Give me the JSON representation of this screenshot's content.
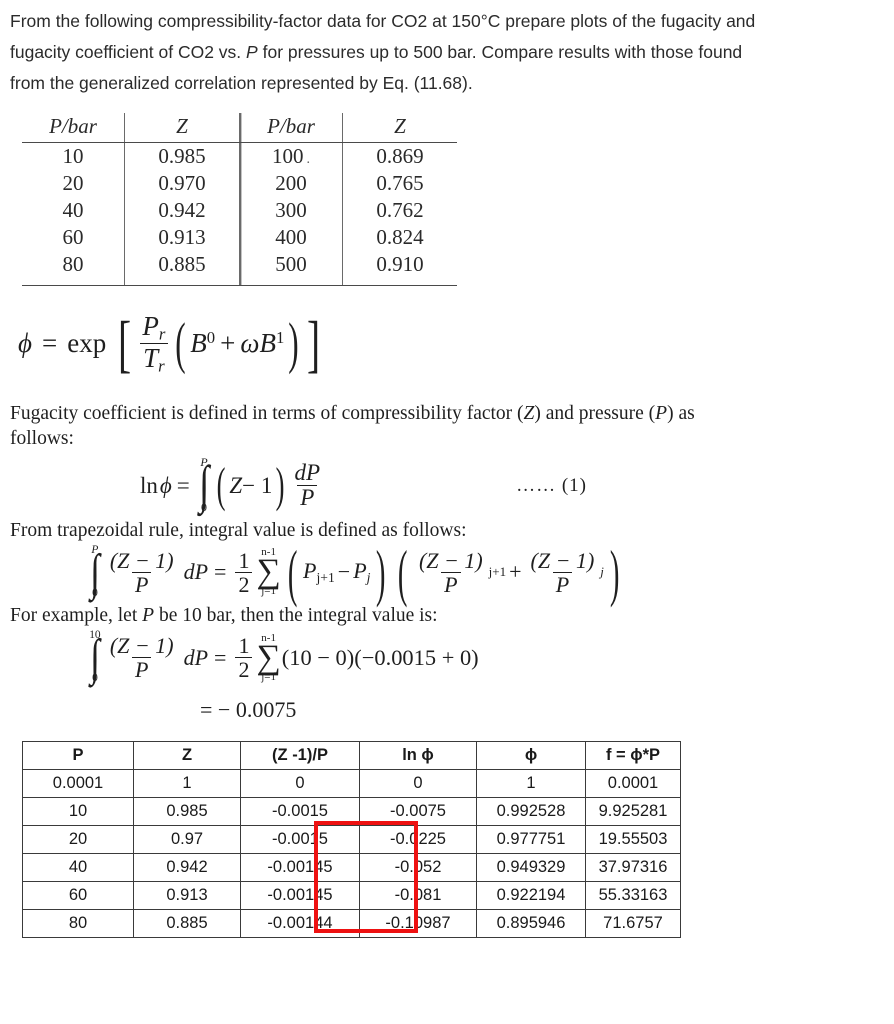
{
  "problem": {
    "text_line1": "From the following compressibility-factor data for CO2 at 150°C prepare plots of the fugacity and",
    "text_line2_a": "fugacity coefficient of CO2 vs. ",
    "text_line2_italic": "P",
    "text_line2_b": " for pressures up to 500 bar. Compare results with those found",
    "text_line3": "from the generalized correlation represented by Eq. (11.68)."
  },
  "z_table": {
    "headers": [
      "P/bar",
      "Z",
      "P/bar",
      "Z"
    ],
    "left_rows": [
      {
        "p": "10",
        "z": "0.985"
      },
      {
        "p": "20",
        "z": "0.970"
      },
      {
        "p": "40",
        "z": "0.942"
      },
      {
        "p": "60",
        "z": "0.913"
      },
      {
        "p": "80",
        "z": "0.885"
      }
    ],
    "right_rows": [
      {
        "p": "100",
        "mark": ".",
        "z": "0.869"
      },
      {
        "p": "200",
        "mark": "",
        "z": "0.765"
      },
      {
        "p": "300",
        "mark": "",
        "z": "0.762"
      },
      {
        "p": "400",
        "mark": "",
        "z": "0.824"
      },
      {
        "p": "500",
        "mark": "",
        "z": "0.910"
      }
    ]
  },
  "phi_formula": {
    "lhs": "ϕ",
    "equals": "=",
    "exp": "exp",
    "numerator": "P",
    "num_sub": "r",
    "denominator": "T",
    "den_sub": "r",
    "body_open": "(",
    "b0": "B",
    "b0_sup": "0",
    "plus": "+",
    "omega": "ω",
    "b1": "B",
    "b1_sup": "1",
    "body_close": ")"
  },
  "definition": {
    "line1": "Fugacity coefficient is defined in terms of compressibility factor (Z) and pressure (P) as",
    "line2": "follows:",
    "z_italic": "Z",
    "p_italic": "P"
  },
  "eq1": {
    "ln": "ln",
    "phi": "ϕ",
    "equals": "=",
    "upper_limit": "P",
    "lower_limit": "0",
    "integrand_open": "(",
    "z": "Z",
    "minus_one": "− 1",
    "integrand_close": ")",
    "frac_num": "dP",
    "frac_den": "P",
    "label": "…… (1)"
  },
  "trapezoid": {
    "intro": "From trapezoidal rule, integral value is defined as follows:",
    "upper_limit": "P",
    "lower_limit": "0",
    "num": "(Z − 1)",
    "den": "P",
    "dP": "dP",
    "equals": "=",
    "half_num": "1",
    "half_den": "2",
    "sum_upper": "n-1",
    "sum_lower": "j=1",
    "sum_sign": "∑",
    "term_p_j1": "P",
    "sub_j1": "j+1",
    "term_minus": "−",
    "term_p_j": "P",
    "sub_j": "j",
    "plus": "+"
  },
  "example": {
    "intro_a": "For example, let ",
    "intro_italic": "P",
    "intro_b": " be 10 bar, then the integral value is:",
    "upper_limit": "10",
    "lower_limit": "0",
    "num": "(Z − 1)",
    "den": "P",
    "dP": "dP",
    "equals": "=",
    "half_num": "1",
    "half_den": "2",
    "sum_upper": "n-1",
    "sum_lower": "j=1",
    "sum_sign": "∑",
    "factor1": "(10 − 0)",
    "factor2": "(−0.0015 + 0)",
    "result": "= − 0.0075"
  },
  "results_table": {
    "headers": [
      "P",
      "Z",
      "(Z -1)/P",
      "ln ϕ",
      "ϕ",
      "f = ϕ*P"
    ],
    "rows": [
      {
        "p": "0.0001",
        "z": "1",
        "zp": "0",
        "lnphi": "0",
        "phi": "1",
        "f": "0.0001"
      },
      {
        "p": "10",
        "z": "0.985",
        "zp": "-0.0015",
        "lnphi": "-0.0075",
        "phi": "0.992528",
        "f": "9.925281"
      },
      {
        "p": "20",
        "z": "0.97",
        "zp": "-0.0015",
        "lnphi": "-0.0225",
        "phi": "0.977751",
        "f": "19.55503"
      },
      {
        "p": "40",
        "z": "0.942",
        "zp": "-0.00145",
        "lnphi": "-0.052",
        "phi": "0.949329",
        "f": "37.97316"
      },
      {
        "p": "60",
        "z": "0.913",
        "zp": "-0.00145",
        "lnphi": "-0.081",
        "phi": "0.922194",
        "f": "55.33163"
      },
      {
        "p": "80",
        "z": "0.885",
        "zp": "-0.00144",
        "lnphi": "-0.10987",
        "phi": "0.895946",
        "f": "71.6757"
      }
    ],
    "highlight_color": "#ee1111"
  }
}
